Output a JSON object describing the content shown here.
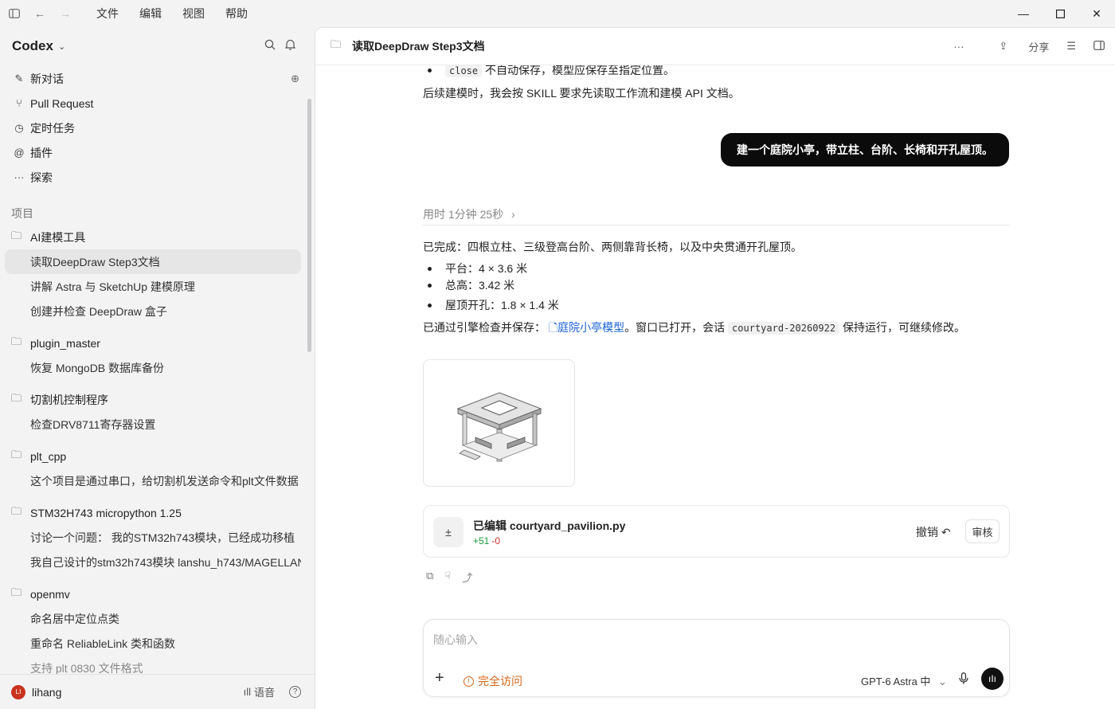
{
  "titlebar": {
    "menu": [
      "文件",
      "编辑",
      "视图",
      "帮助"
    ]
  },
  "sidebar": {
    "app_name": "Codex",
    "nav": [
      {
        "label": "新对话",
        "icon": "compose-icon"
      },
      {
        "label": "Pull Request",
        "icon": "git-pull-request-icon"
      },
      {
        "label": "定时任务",
        "icon": "clock-icon"
      },
      {
        "label": "插件",
        "icon": "at-icon"
      },
      {
        "label": "探索",
        "icon": "more-icon"
      }
    ],
    "projects_label": "项目",
    "projects": [
      {
        "name": "AI建模工具",
        "threads": [
          "读取DeepDraw Step3文档",
          "讲解 Astra 与 SketchUp 建模原理",
          "创建并检查 DeepDraw 盒子"
        ]
      },
      {
        "name": "plugin_master",
        "threads": [
          "恢复 MongoDB 数据库备份"
        ]
      },
      {
        "name": "切割机控制程序",
        "threads": [
          "检查DRV8711寄存器设置"
        ]
      },
      {
        "name": "plt_cpp",
        "threads": [
          "这个项目是通过串口，给切割机发送命令和plt文件数据"
        ]
      },
      {
        "name": "STM32H743 micropython 1.25",
        "threads": [
          "讨论一个问题： 我的STM32h743模块，已经成功移植",
          "我自己设计的stm32h743模块 lanshu_h743/MAGELLAN"
        ]
      },
      {
        "name": "openmv",
        "threads": [
          "命名居中定位点类",
          "重命名 ReliableLink 类和函数",
          "支持 plt 0830 文件格式"
        ]
      }
    ],
    "user": {
      "name": "lihang",
      "avatar_text": "LI"
    },
    "voice_label": "语音",
    "help_label": "?"
  },
  "main": {
    "title": "读取DeepDraw Step3文档",
    "share_label": "分享",
    "prev_bullet_code": "close",
    "prev_bullet_text": "不自动保存，模型应保存至指定位置。",
    "prev_paragraph": "后续建模时，我会按 SKILL 要求先读取工作流和建模 API 文档。",
    "user_message": "建一个庭院小亭，带立柱、台阶、长椅和开孔屋顶。",
    "elapsed": "用时 1分钟 25秒",
    "summary": "已完成：四根立柱、三级登高台阶、两侧靠背长椅，以及中央贯通开孔屋顶。",
    "bullets": [
      "平台：4 × 3.6 米",
      "总高：3.42 米",
      "屋顶开孔：1.8 × 1.4 米"
    ],
    "saved_prefix": "已通过引擎检查并保存：",
    "saved_link": "庭院小亭模型",
    "saved_middle": "。窗口已打开，会话",
    "session_code": "courtyard-20260922",
    "saved_suffix": "保持运行，可继续修改。",
    "edit": {
      "title": "已编辑 courtyard_pavilion.py",
      "added": "+51",
      "removed": "-0",
      "undo": "撤销 ↶",
      "review": "审核"
    },
    "composer": {
      "placeholder": "随心输入",
      "access": "完全访问",
      "model": "GPT-6 Astra 中"
    }
  }
}
